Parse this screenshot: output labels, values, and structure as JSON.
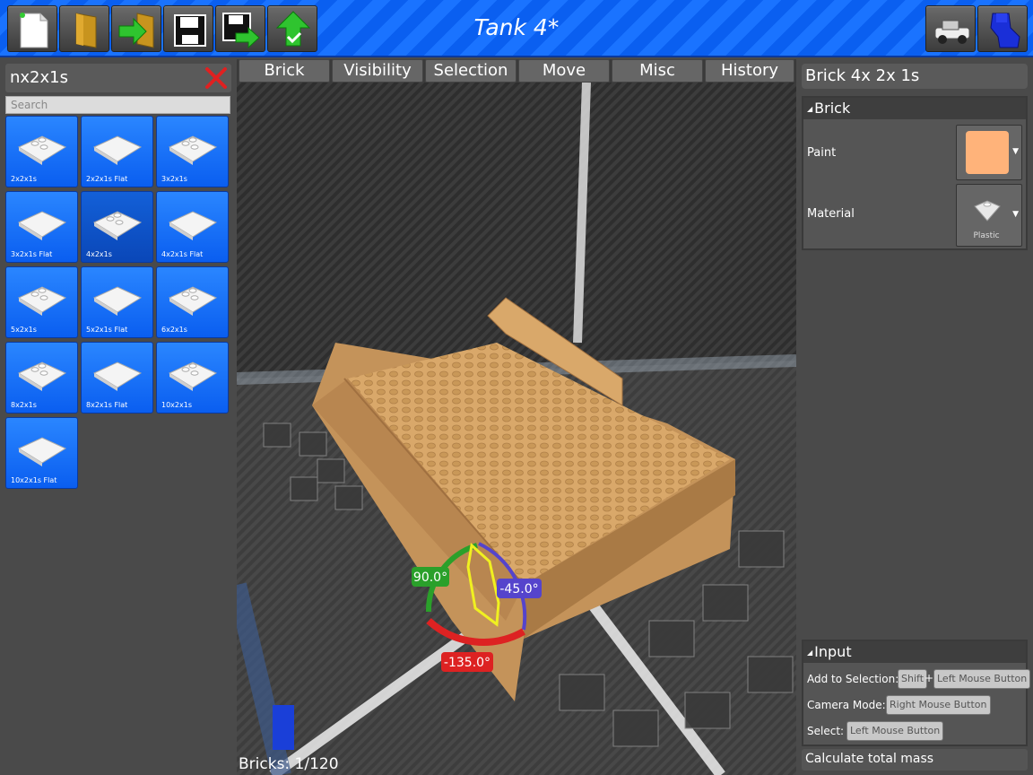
{
  "toolbar": {
    "title": "Tank 4*",
    "buttons": [
      "new-file-icon",
      "open-folder-icon",
      "import-icon",
      "save-icon",
      "save-as-icon",
      "upload-icon"
    ],
    "right_buttons": [
      "vehicle-icon",
      "character-icon"
    ]
  },
  "catalog": {
    "title": "nx2x1s",
    "search_placeholder": "Search",
    "items": [
      {
        "label": "2x2x1s",
        "selected": false
      },
      {
        "label": "2x2x1s Flat",
        "selected": false
      },
      {
        "label": "3x2x1s",
        "selected": false
      },
      {
        "label": "3x2x1s Flat",
        "selected": false
      },
      {
        "label": "4x2x1s",
        "selected": true
      },
      {
        "label": "4x2x1s Flat",
        "selected": false
      },
      {
        "label": "5x2x1s",
        "selected": false
      },
      {
        "label": "5x2x1s Flat",
        "selected": false
      },
      {
        "label": "6x2x1s",
        "selected": false
      },
      {
        "label": "8x2x1s",
        "selected": false
      },
      {
        "label": "8x2x1s Flat",
        "selected": false
      },
      {
        "label": "10x2x1s",
        "selected": false
      },
      {
        "label": "10x2x1s Flat",
        "selected": false
      }
    ]
  },
  "menu": {
    "tabs": [
      "Brick",
      "Visibility",
      "Selection",
      "Move",
      "Misc",
      "History"
    ]
  },
  "viewport": {
    "gizmo_labels": [
      "90.0°",
      "-45.0°",
      "-135.0°"
    ],
    "bricks_count": "Bricks: 1/120"
  },
  "inspector": {
    "title": "Brick 4x 2x 1s",
    "brick_section": "Brick",
    "paint_label": "Paint",
    "paint_color": "#ffb37a",
    "material_label": "Material",
    "material_value": "Plastic",
    "input_section": "Input",
    "add_selection_label": "Add to Selection:",
    "shift_key": "Shift",
    "plus": "+",
    "left_mouse": "Left Mouse Button",
    "camera_mode_label": "Camera Mode:",
    "right_mouse": "Right Mouse Button",
    "select_label": "Select:",
    "select_mouse": "Left Mouse Button",
    "calc_mass": "Calculate total mass"
  },
  "colors": {
    "accent_blue": "#1a73ff",
    "brick_tan": "#d9a86a",
    "gizmo_green": "#2aa02a",
    "gizmo_purple": "#5544cc",
    "gizmo_red": "#dd2222"
  }
}
